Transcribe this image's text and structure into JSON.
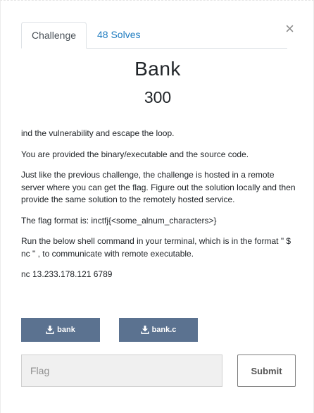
{
  "modal": {
    "close_glyph": "×"
  },
  "tabs": [
    {
      "label": "Challenge",
      "active": true
    },
    {
      "label": "48 Solves",
      "active": false
    }
  ],
  "challenge": {
    "name": "Bank",
    "points": "300",
    "description": [
      "ind the vulnerability and escape the loop.",
      "You are provided the binary/executable and the source code.",
      "Just like the previous challenge, the challenge is hosted in a remote server where you can get the flag. Figure out the solution locally and then provide the same solution to the remotely hosted service.",
      "The flag format is: inctfj{<some_alnum_characters>}",
      "Run the below shell command in your terminal, which is in the format \" $ nc \" , to communicate with remote executable.",
      "nc 13.233.178.121 6789"
    ]
  },
  "files": [
    {
      "label": "bank",
      "icon": "download-icon"
    },
    {
      "label": "bank.c",
      "icon": "download-icon"
    }
  ],
  "submission": {
    "placeholder": "Flag",
    "value": "",
    "submit_label": "Submit"
  },
  "colors": {
    "tab_link": "#1f7cc0",
    "file_button": "#5b7290",
    "input_bg": "#f0f0f0"
  }
}
